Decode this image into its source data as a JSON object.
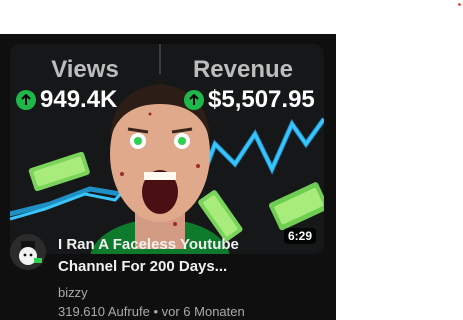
{
  "video": {
    "thumbnail": {
      "views_header": "Views",
      "revenue_header": "Revenue",
      "views_value": "949.4K",
      "revenue_value": "$5,507.95",
      "duration": "6:29",
      "arrow_icon": "arrow-up-icon",
      "accent_color": "#1fb64a",
      "line_color": "#39c6ff"
    },
    "title_line1": "I Ran A Faceless Youtube",
    "title_line2": "Channel For 200 Days...",
    "channel_name": "bizzy",
    "views_text": "319.610 Aufrufe",
    "separator": "•",
    "age_text": "vor 6 Monaten"
  },
  "colors": {
    "page_dot": "#e8565b",
    "card_bg": "#0f0f0f",
    "text_primary": "#f1f1f1",
    "text_secondary": "#aaaaaa"
  }
}
